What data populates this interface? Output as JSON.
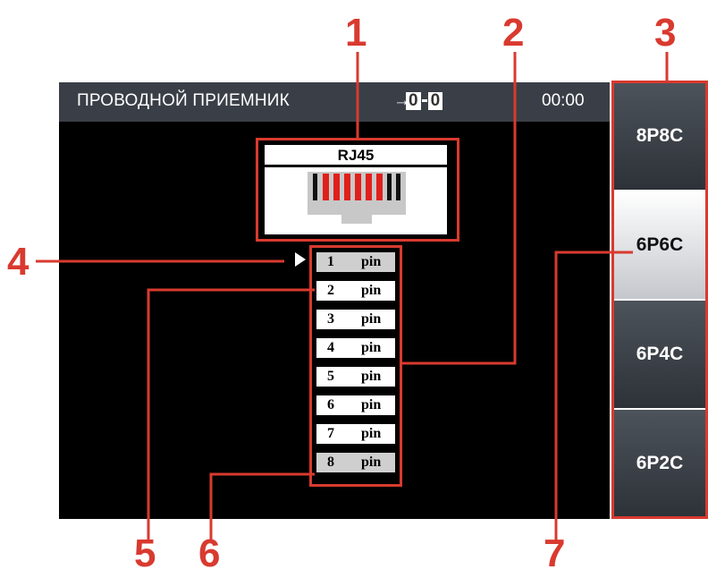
{
  "header": {
    "title": "ПРОВОДНОЙ ПРИЕМНИК",
    "indicator_arrow": "→",
    "indicator_left": "0",
    "indicator_right": "0",
    "time": "00:00"
  },
  "connector": {
    "label": "RJ45"
  },
  "pins": [
    {
      "num": "1",
      "label": "pin"
    },
    {
      "num": "2",
      "label": "pin"
    },
    {
      "num": "3",
      "label": "pin"
    },
    {
      "num": "4",
      "label": "pin"
    },
    {
      "num": "5",
      "label": "pin"
    },
    {
      "num": "6",
      "label": "pin"
    },
    {
      "num": "7",
      "label": "pin"
    },
    {
      "num": "8",
      "label": "pin"
    }
  ],
  "sidebar": {
    "items": [
      {
        "label": "8P8C"
      },
      {
        "label": "6P6C"
      },
      {
        "label": "6P4C"
      },
      {
        "label": "6P2C"
      }
    ],
    "selected": "6P6C"
  },
  "callouts": [
    "1",
    "2",
    "3",
    "4",
    "5",
    "6",
    "7"
  ],
  "colors": {
    "accent": "#d93a2f",
    "header": "#3a3f47",
    "wire_red": "#e0201b"
  }
}
